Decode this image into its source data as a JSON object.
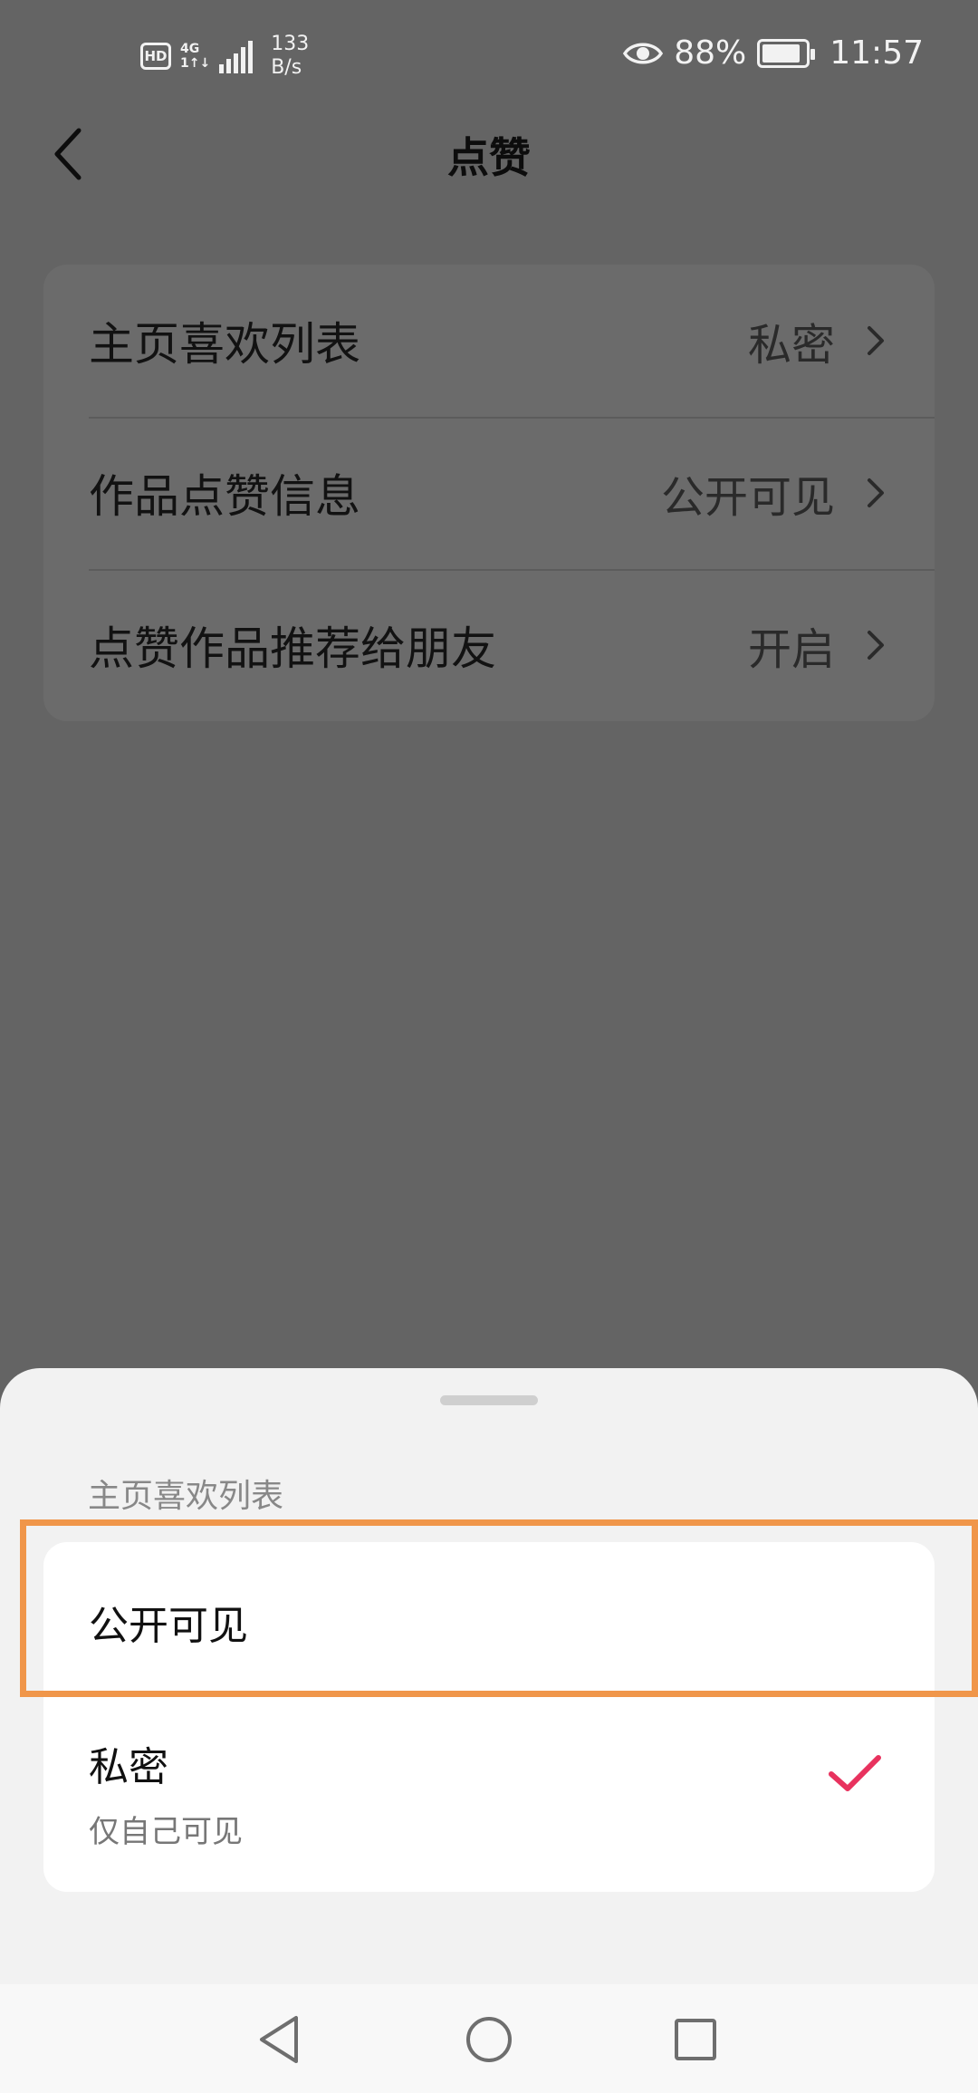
{
  "status_bar": {
    "hd": "HD",
    "network_top": "4G",
    "network_bottom": "1↑↓",
    "speed_value": "133",
    "speed_unit": "B/s",
    "battery_percent": "88%",
    "battery_level": 0.88,
    "time": "11:57",
    "icons": [
      "eye-icon",
      "battery-icon",
      "signal-icon"
    ]
  },
  "header": {
    "title": "点赞",
    "back_icon": "chevron-left-icon"
  },
  "settings": {
    "items": [
      {
        "label": "主页喜欢列表",
        "value": "私密"
      },
      {
        "label": "作品点赞信息",
        "value": "公开可见"
      },
      {
        "label": "点赞作品推荐给朋友",
        "value": "开启"
      }
    ]
  },
  "sheet": {
    "title": "主页喜欢列表",
    "options": [
      {
        "label": "公开可见",
        "sub": "",
        "selected": false
      },
      {
        "label": "私密",
        "sub": "仅自己可见",
        "selected": true
      }
    ]
  },
  "colors": {
    "accent_check": "#e8325e",
    "highlight": "#f0964a",
    "overlay_bg": "#646464",
    "sheet_bg": "#f2f2f2"
  },
  "nav_bar": {
    "icons": [
      "back-triangle-icon",
      "home-circle-icon",
      "recents-square-icon"
    ]
  }
}
